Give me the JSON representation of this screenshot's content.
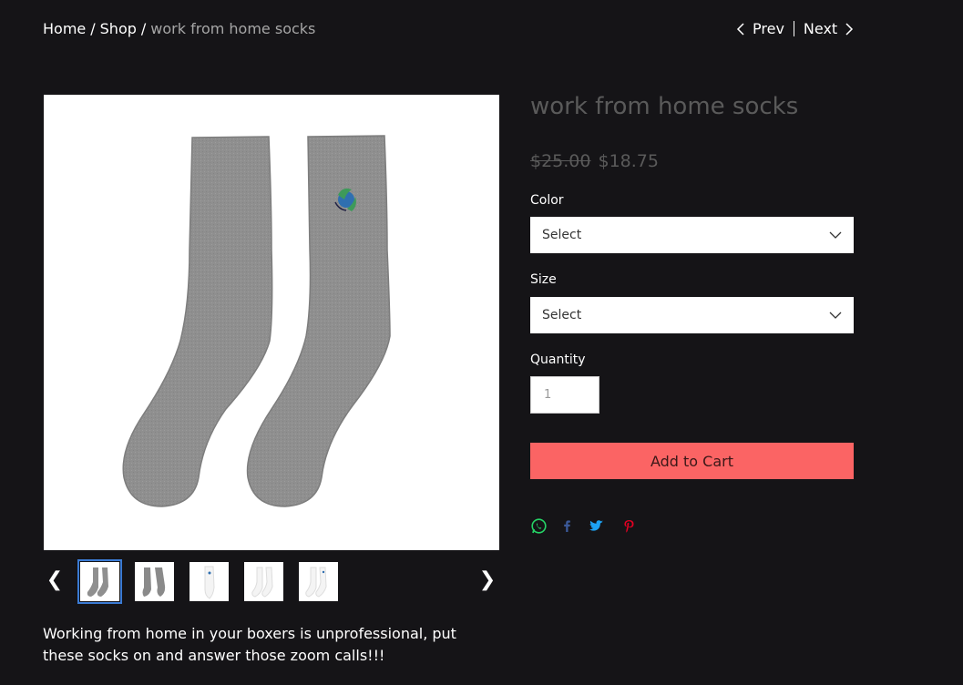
{
  "breadcrumb": {
    "home": "Home",
    "shop": "Shop",
    "separator": "/",
    "current": "work from home socks"
  },
  "pager": {
    "prev": "Prev",
    "next": "Next"
  },
  "product": {
    "title": "work from home socks",
    "price_original": "$25.00",
    "price_sale": "$18.75",
    "description": "Working from home in your boxers is unprofessional, put these socks on and answer those zoom calls!!!"
  },
  "options": {
    "color_label": "Color",
    "color_value": "Select",
    "size_label": "Size",
    "size_value": "Select",
    "quantity_label": "Quantity",
    "quantity_value": "1"
  },
  "cart": {
    "add_label": "Add to Cart"
  },
  "gallery": {
    "prev_arrow": "❮",
    "next_arrow": "❯",
    "thumbnails": [
      {
        "name": "thumb-grey-socks-1",
        "variant": "grey"
      },
      {
        "name": "thumb-grey-socks-2",
        "variant": "grey"
      },
      {
        "name": "thumb-white-sock-1",
        "variant": "white"
      },
      {
        "name": "thumb-white-socks-2",
        "variant": "white"
      },
      {
        "name": "thumb-white-socks-3",
        "variant": "white"
      }
    ]
  },
  "share": {
    "icons": [
      "whatsapp-icon",
      "facebook-icon",
      "twitter-icon",
      "pinterest-icon"
    ]
  },
  "colors": {
    "background": "#151417",
    "accent_button": "#fb6464",
    "muted_text": "#5a5a5a",
    "whatsapp": "#25d366",
    "facebook": "#3b5998",
    "twitter": "#1da1f2",
    "pinterest": "#e60023"
  }
}
